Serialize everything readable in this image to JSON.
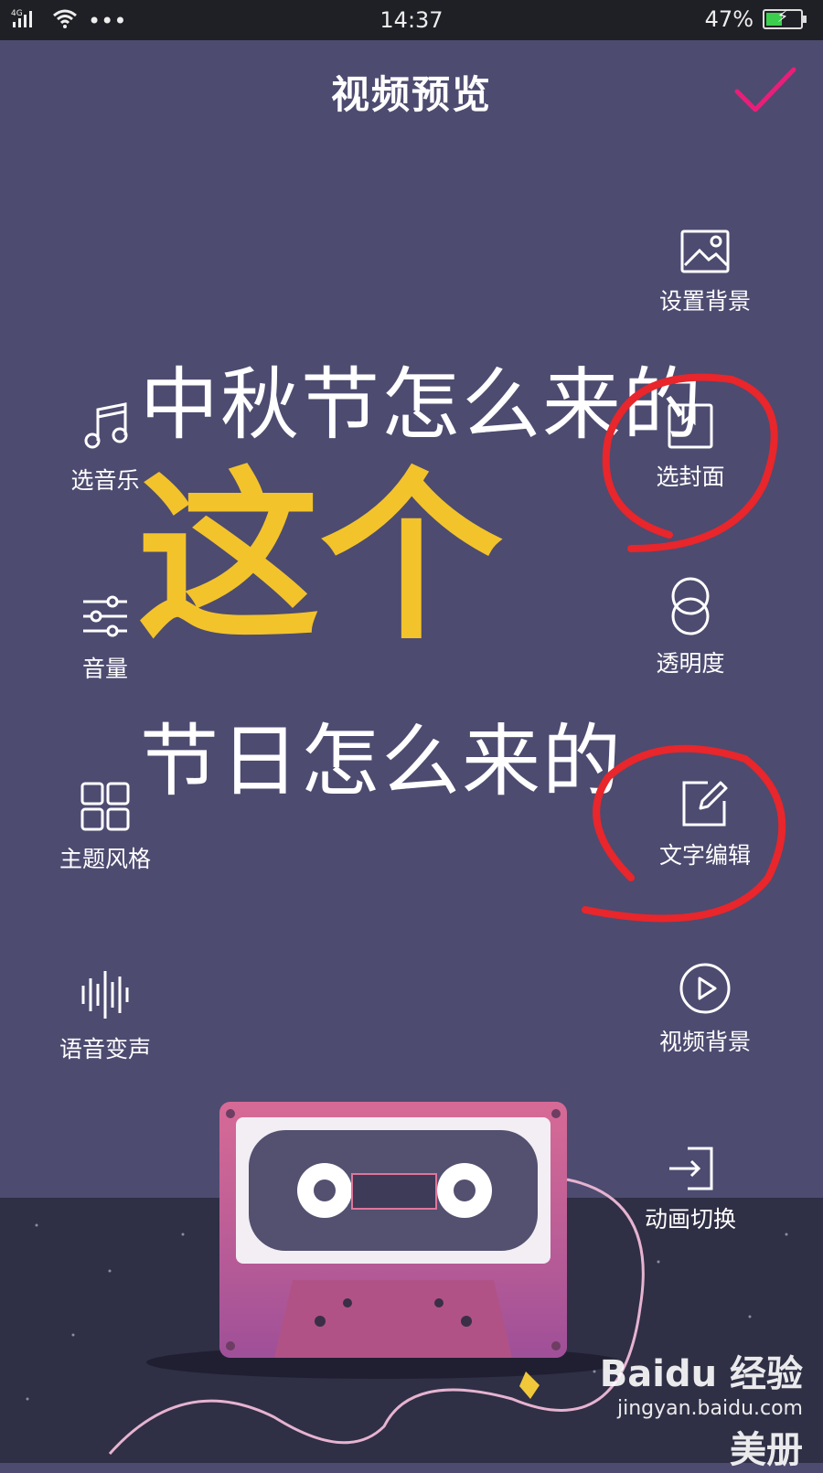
{
  "status_bar": {
    "network": "4G",
    "more": "•••",
    "time": "14:37",
    "battery": "47%",
    "battery_level": 0.47
  },
  "header": {
    "title": "视频预览"
  },
  "left_tools": [
    {
      "label": "选音乐",
      "icon": "music-note-icon"
    },
    {
      "label": "音量",
      "icon": "sliders-icon"
    },
    {
      "label": "主题风格",
      "icon": "grid-icon"
    },
    {
      "label": "语音变声",
      "icon": "voice-wave-icon"
    }
  ],
  "right_tools": [
    {
      "label": "设置背景",
      "icon": "image-icon"
    },
    {
      "label": "选封面",
      "icon": "bookmark-icon"
    },
    {
      "label": "透明度",
      "icon": "overlap-circles-icon"
    },
    {
      "label": "文字编辑",
      "icon": "edit-icon"
    },
    {
      "label": "视频背景",
      "icon": "play-circle-icon"
    },
    {
      "label": "动画切换",
      "icon": "enter-icon"
    }
  ],
  "preview": {
    "line1": "中秋节怎么来的",
    "line2": "这个",
    "line3": "节日怎么来的"
  },
  "watermark": {
    "brand": "Baidu 经验",
    "url": "jingyan.baidu.com",
    "extra": "美册"
  },
  "colors": {
    "background": "#4d4b70",
    "accent": "#e91e78",
    "highlight_text": "#f3c32b",
    "annotation": "#e8262b"
  }
}
